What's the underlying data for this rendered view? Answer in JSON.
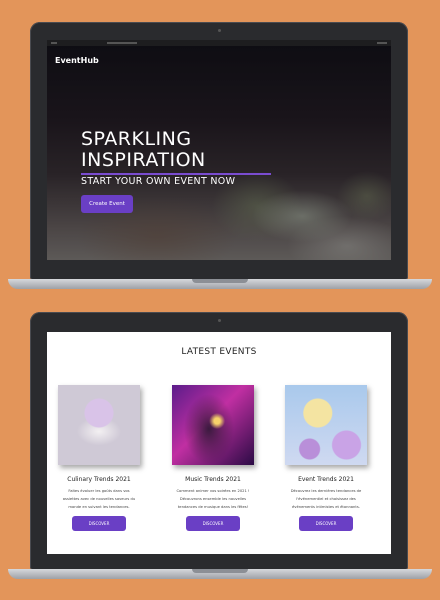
{
  "hero": {
    "logo": "EventHub",
    "title_line1": "SPARKLING",
    "title_line2": "INSPIRATION",
    "subtitle": "START YOUR OWN EVENT NOW",
    "cta_label": "Create Event"
  },
  "events": {
    "title": "LATEST EVENTS",
    "cards": [
      {
        "title": "Culinary Trends 2021",
        "description": "Faites évoluer les goûts dans vos assiettes avec de nouvelles saveurs du monde en suivant les tendances.",
        "button": "DISCOVER"
      },
      {
        "title": "Music Trends 2021",
        "description": "Comment animer vos soirées en 2021 ! Découvrons ensemble les nouvelles tendances de musique dans les fêtes!",
        "button": "DISCOVER"
      },
      {
        "title": "Event Trends 2021",
        "description": "Découvrez les dernières tendances de l'événementiel et choisissez des événements intimistes et étonnants.",
        "button": "DISCOVER"
      }
    ]
  },
  "colors": {
    "background": "#E3955A",
    "accent": "#6A3FC5"
  }
}
